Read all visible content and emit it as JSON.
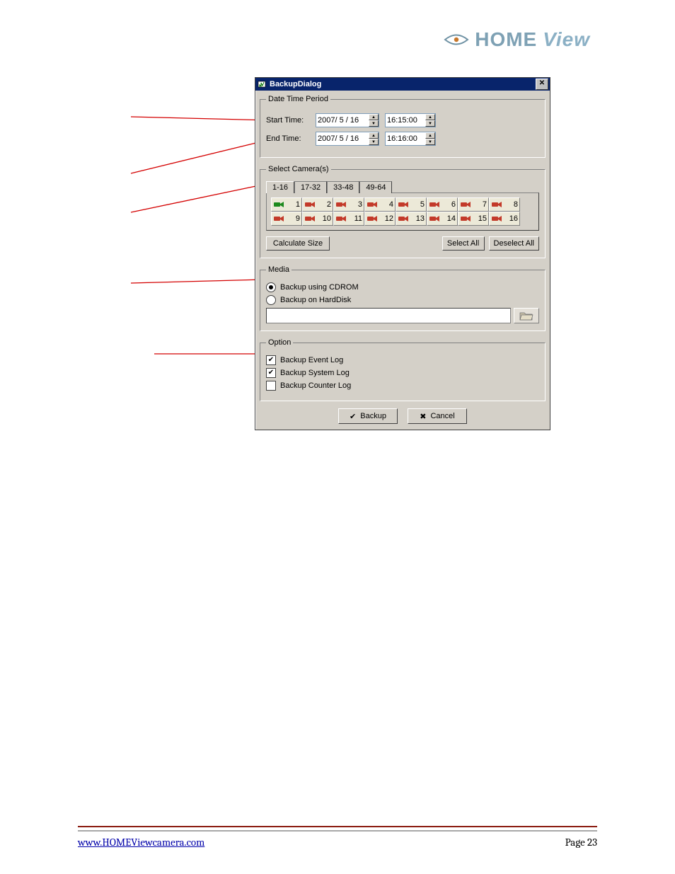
{
  "header": {
    "brand_home": "HOME",
    "brand_view": "View"
  },
  "dialog": {
    "title": "BackupDialog",
    "datetime": {
      "legend": "Date Time Period",
      "start_label": "Start Time:",
      "start_date": "2007/ 5 / 16",
      "start_time": "16:15:00",
      "end_label": "End Time:",
      "end_date": "2007/ 5 / 16",
      "end_time": "16:16:00"
    },
    "cameras": {
      "legend": "Select Camera(s)",
      "tabs": [
        "1-16",
        "17-32",
        "33-48",
        "49-64"
      ],
      "active_tab": 0,
      "cells": [
        "1",
        "2",
        "3",
        "4",
        "5",
        "6",
        "7",
        "8",
        "9",
        "10",
        "11",
        "12",
        "13",
        "14",
        "15",
        "16"
      ],
      "calc_label": "Calculate Size",
      "select_all_label": "Select All",
      "deselect_all_label": "Deselect All"
    },
    "media": {
      "legend": "Media",
      "opt_cdrom": "Backup using CDROM",
      "opt_hdd": "Backup on HardDisk",
      "selected": "cdrom",
      "path": ""
    },
    "option": {
      "legend": "Option",
      "event_log": "Backup Event Log",
      "system_log": "Backup System Log",
      "counter_log": "Backup Counter Log",
      "event_checked": true,
      "system_checked": true,
      "counter_checked": false
    },
    "buttons": {
      "backup": "Backup",
      "cancel": "Cancel"
    }
  },
  "footer": {
    "url_text": "www.HOMEViewcamera.com",
    "page_text": "Page 23"
  }
}
